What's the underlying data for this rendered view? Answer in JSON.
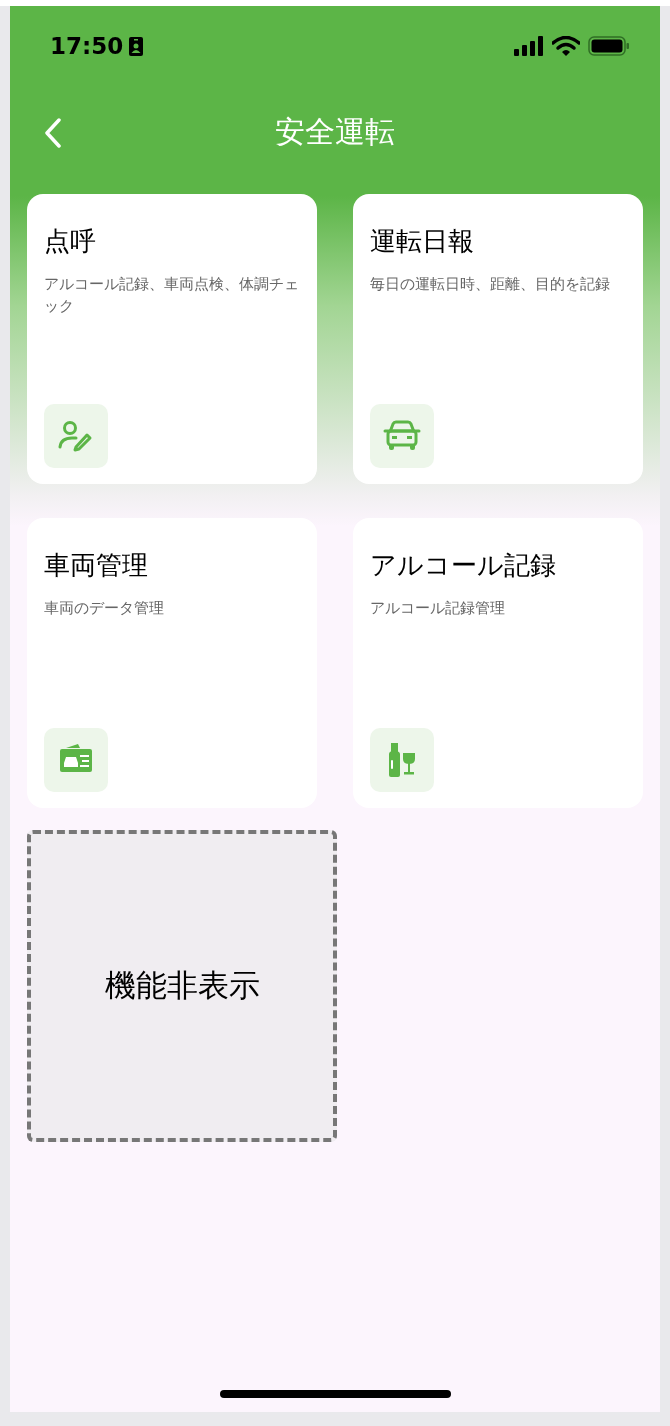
{
  "status_bar": {
    "time": "17:50"
  },
  "header": {
    "title": "安全運転"
  },
  "tiles": [
    {
      "kind": "feature",
      "title": "点呼",
      "description": "アルコール記録、車両点検、体調チェック"
    },
    {
      "kind": "feature",
      "title": "運転日報",
      "description": "毎日の運転日時、距離、目的を記録"
    },
    {
      "kind": "feature",
      "title": "車両管理",
      "description": "車両のデータ管理"
    },
    {
      "kind": "feature",
      "title": "アルコール記録",
      "description": "アルコール記録管理"
    },
    {
      "kind": "hidden",
      "title": "機能非表示"
    }
  ]
}
